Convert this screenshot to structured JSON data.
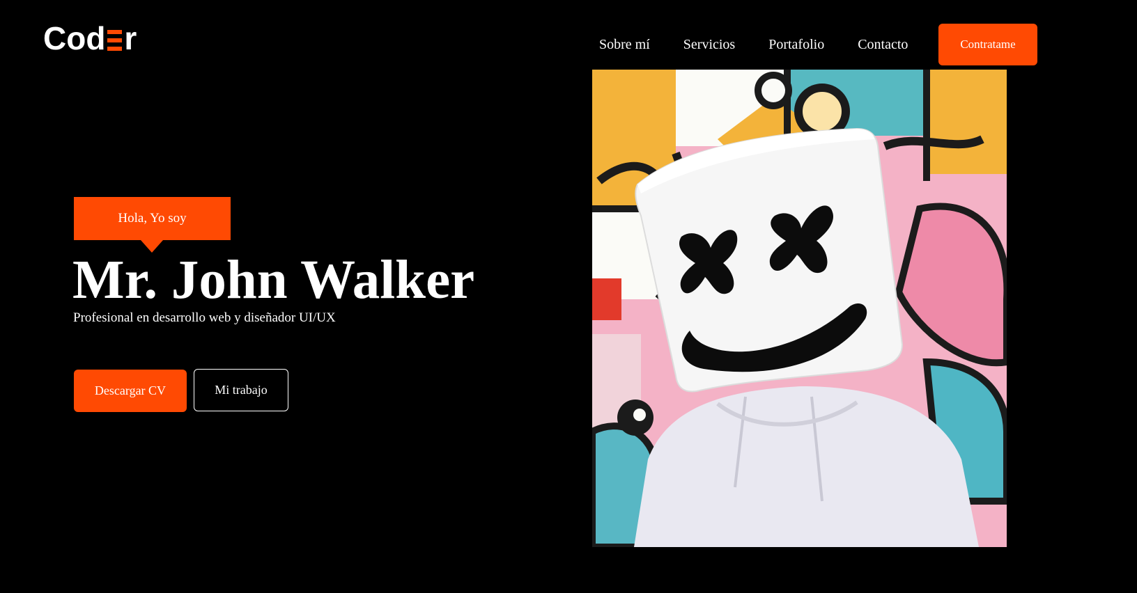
{
  "header": {
    "logo": {
      "text_left": "Cod",
      "text_right": "r",
      "accent_color": "#ff4a03"
    },
    "nav": [
      "Sobre mí",
      "Servicios",
      "Portafolio",
      "Contacto"
    ],
    "cta_label": "Contratame"
  },
  "hero": {
    "greeting": "Hola, Yo soy",
    "name": "Mr. John Walker",
    "subtitle": "Profesional en desarrollo web y diseñador UI/UX",
    "primary_button": "Descargar CV",
    "secondary_button": "Mi trabajo",
    "image": {
      "subject": "person wearing a white smiley-face helmet and white hoodie in front of a colorful mural"
    }
  },
  "colors": {
    "accent": "#ff4a03",
    "background": "#000000",
    "text": "#ffffff"
  }
}
